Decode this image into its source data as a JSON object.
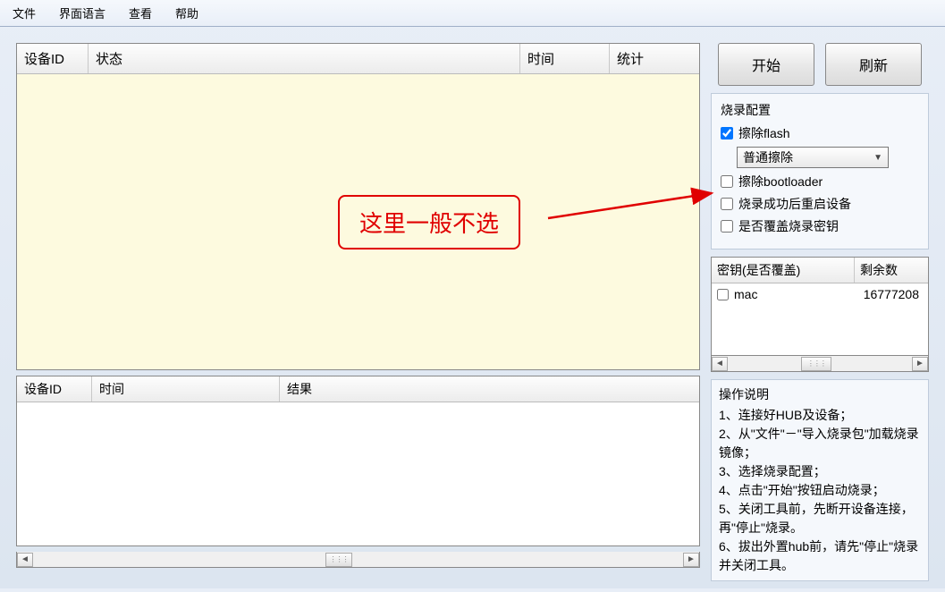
{
  "menu": {
    "file": "文件",
    "lang": "界面语言",
    "view": "查看",
    "help": "帮助"
  },
  "top_table": {
    "headers": {
      "devid": "设备ID",
      "status": "状态",
      "time": "时间",
      "stats": "统计"
    }
  },
  "bottom_table": {
    "headers": {
      "devid": "设备ID",
      "time": "时间",
      "result": "结果"
    }
  },
  "buttons": {
    "start": "开始",
    "refresh": "刷新"
  },
  "burn_config": {
    "title": "烧录配置",
    "erase_flash": "擦除flash",
    "erase_mode": "普通擦除",
    "erase_bootloader": "擦除bootloader",
    "reboot_after": "烧录成功后重启设备",
    "overwrite_key": "是否覆盖烧录密钥"
  },
  "key_table": {
    "headers": {
      "key": "密钥(是否覆盖)",
      "remain": "剩余数"
    },
    "rows": [
      {
        "name": "mac",
        "remain": "16777208"
      }
    ]
  },
  "instructions": {
    "title": "操作说明",
    "lines": [
      "1、连接好HUB及设备；",
      "2、从\"文件\"－\"导入烧录包\"加载烧录镜像；",
      "3、选择烧录配置；",
      "4、点击\"开始\"按钮启动烧录；",
      "5、关闭工具前，先断开设备连接，再\"停止\"烧录。",
      "6、拔出外置hub前，请先\"停止\"烧录并关闭工具。"
    ]
  },
  "annotation": "这里一般不选"
}
